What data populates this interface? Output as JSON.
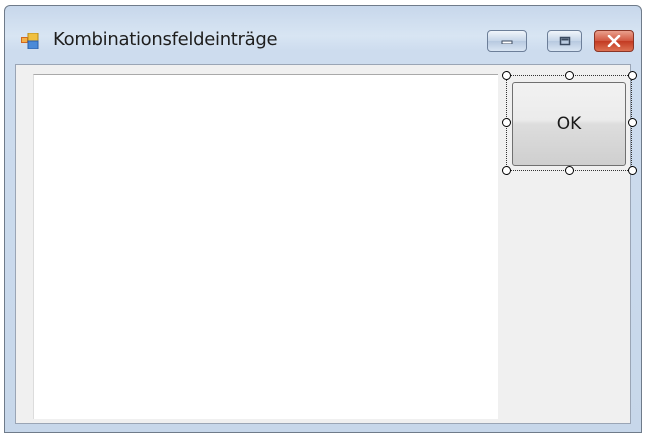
{
  "window": {
    "title": "Kombinationsfeldeinträge",
    "icon": "form-icon",
    "caption_buttons": [
      "minimize-icon",
      "maximize-icon",
      "close-icon"
    ]
  },
  "form": {
    "ok_button_label": "OK",
    "listbox_items": []
  },
  "colors": {
    "titlebar": "#cddcee",
    "client_background": "#f0f0f0",
    "close_button": "#c33a22",
    "listbox_background": "#ffffff"
  }
}
